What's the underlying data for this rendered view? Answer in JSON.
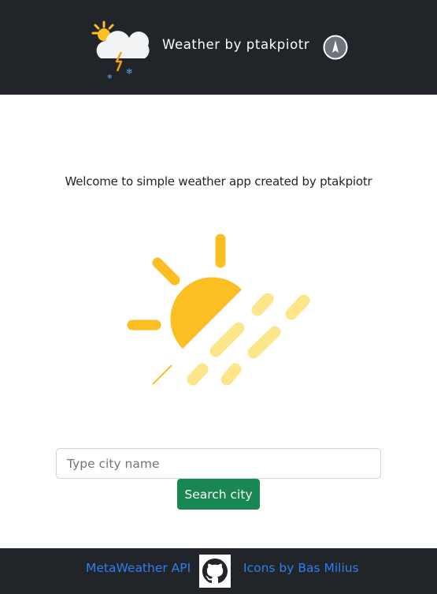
{
  "header": {
    "logo_icon": "sun-cloud-thunder-snow-icon",
    "title": "Weather by ptakpiotr",
    "compass_icon": "compass-icon"
  },
  "main": {
    "welcome_text": "Welcome to simple weather app created by ptakpiotr",
    "hero_icon": "sun-rain-icon",
    "search": {
      "placeholder": "Type city name",
      "value": "",
      "button_label": "Search city"
    }
  },
  "footer": {
    "api_link": "MetaWeather API",
    "github_icon": "github-icon",
    "icons_link": "Icons by Bas Milius"
  },
  "colors": {
    "dark": "#212529",
    "accent_green": "#198754",
    "link_blue": "#2f7df0",
    "sun_yellow": "#fbbf24"
  }
}
